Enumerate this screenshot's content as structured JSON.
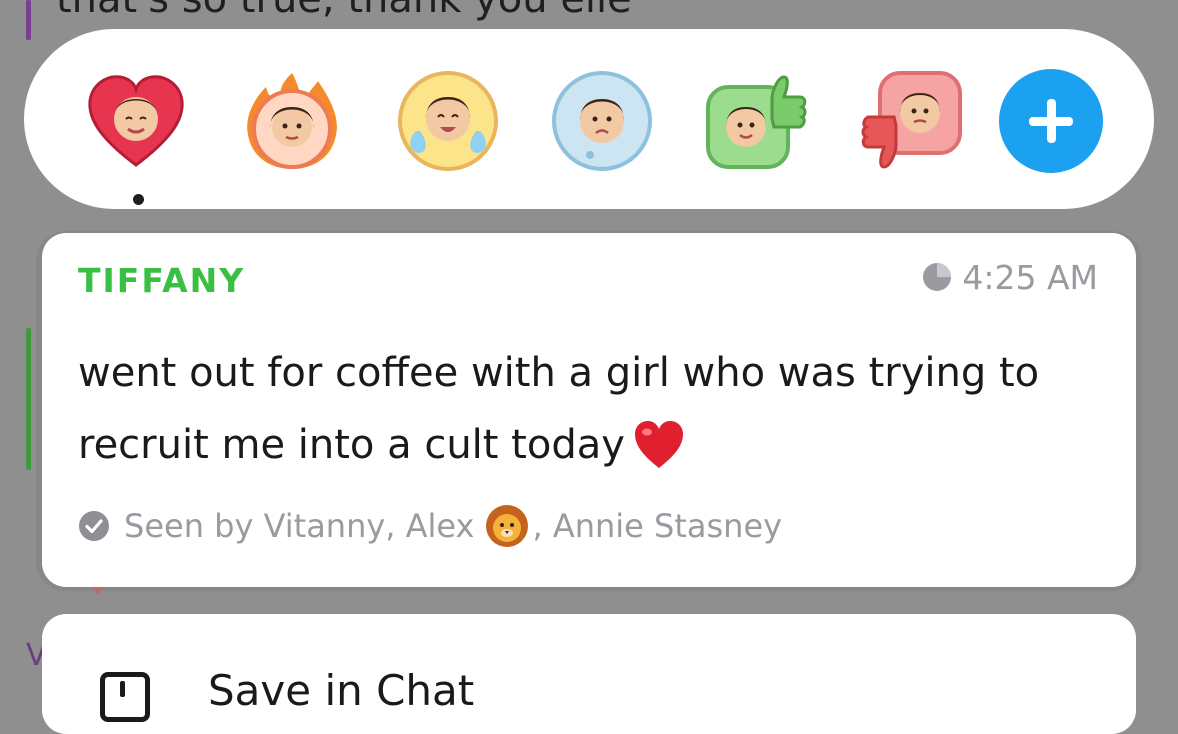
{
  "background": {
    "previous_message": "that's so true, thank you elle",
    "next_initial": "V"
  },
  "reaction_bar": {
    "reactions": [
      {
        "icon": "heart-bitmoji-icon",
        "selected": true
      },
      {
        "icon": "fire-bitmoji-icon"
      },
      {
        "icon": "laughing-tears-bitmoji-icon"
      },
      {
        "icon": "sad-bitmoji-icon"
      },
      {
        "icon": "thumbs-up-bitmoji-icon"
      },
      {
        "icon": "thumbs-down-bitmoji-icon"
      }
    ],
    "add_icon": "plus-icon",
    "accent": "#1ca1f1"
  },
  "message": {
    "sender": "TIFFANY",
    "sender_color": "#39c043",
    "time": "4:25 AM",
    "text": "went out for coffee with a girl who was trying to recruit me into a cult today",
    "emoji": "red-heart",
    "seen_prefix": "Seen by Vitanny, Alex",
    "seen_emoji": "lion-face",
    "seen_suffix": ", Annie Stasney"
  },
  "actions": {
    "save_label": "Save in Chat"
  }
}
